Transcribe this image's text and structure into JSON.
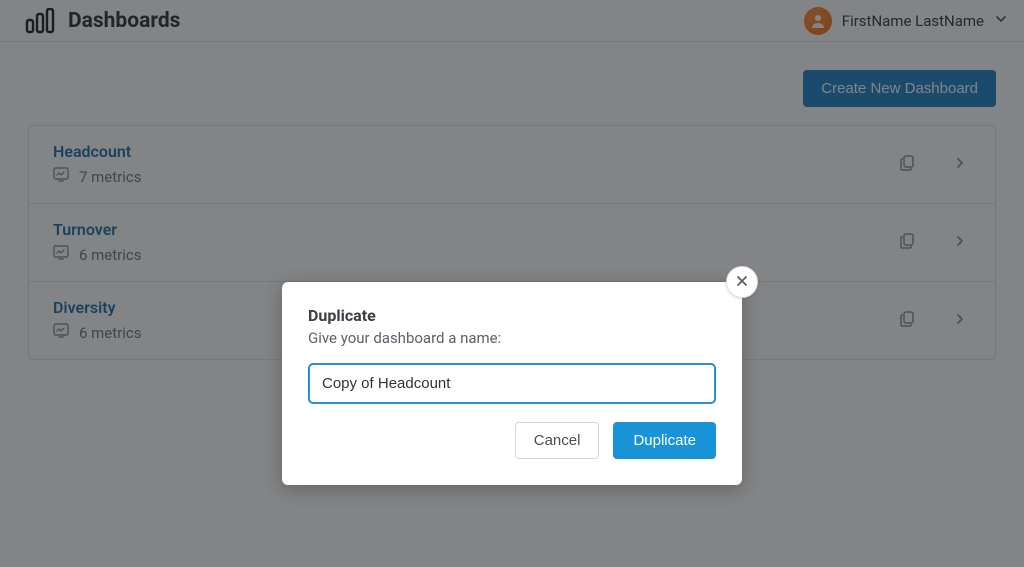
{
  "header": {
    "title": "Dashboards",
    "user_name": "FirstName LastName"
  },
  "actions": {
    "create_label": "Create New Dashboard"
  },
  "dashboards": [
    {
      "name": "Headcount",
      "metrics": "7 metrics"
    },
    {
      "name": "Turnover",
      "metrics": "6 metrics"
    },
    {
      "name": "Diversity",
      "metrics": "6 metrics"
    }
  ],
  "modal": {
    "title": "Duplicate",
    "subtitle": "Give your dashboard a name:",
    "input_value": "Copy of Headcount",
    "cancel_label": "Cancel",
    "confirm_label": "Duplicate"
  }
}
